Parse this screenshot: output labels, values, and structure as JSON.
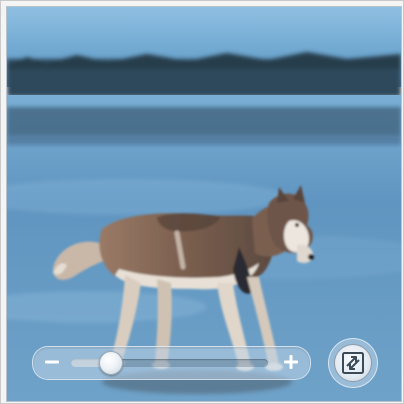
{
  "viewer": {
    "image_subject": "husky-dog-on-frozen-lake",
    "zoom_level": 0.2
  },
  "controls": {
    "zoom_out_icon": "minus-icon",
    "zoom_in_icon": "plus-icon",
    "fullscreen_icon": "expand-arrows-icon"
  },
  "colors": {
    "sky": "#6fa6cf",
    "ice": "#5e93bd",
    "control_tint": "#bed4e8"
  }
}
